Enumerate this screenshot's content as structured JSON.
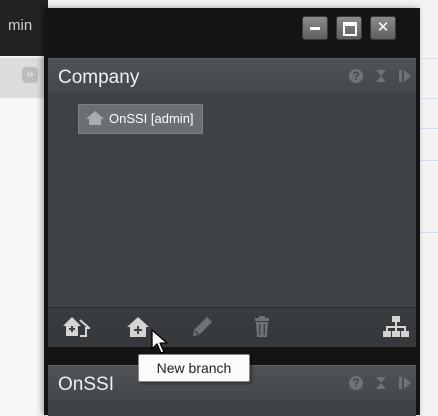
{
  "background_window": {
    "title_fragment": "min"
  },
  "window_controls": {
    "minimize_icon": "minimize-icon",
    "maximize_icon": "maximize-icon",
    "close_symbol": "✕"
  },
  "company_panel": {
    "title": "Company",
    "header_icons": [
      "help-icon",
      "collapse-icon",
      "detach-icon"
    ],
    "help_glyph": "?",
    "tree": {
      "selected_node": "OnSSI [admin]",
      "node_icon": "home-icon"
    },
    "toolbar": [
      "new-site-icon",
      "new-branch-icon",
      "edit-icon",
      "delete-icon",
      "hierarchy-icon"
    ]
  },
  "onssi_panel": {
    "title": "OnSSI",
    "help_glyph": "?"
  },
  "tooltip": {
    "text": "New branch"
  },
  "colors": {
    "window": "#141414",
    "panel": "#3e4145",
    "header": "#4a4e52",
    "icon": "#d4d4d4",
    "muted": "#6f7378"
  }
}
